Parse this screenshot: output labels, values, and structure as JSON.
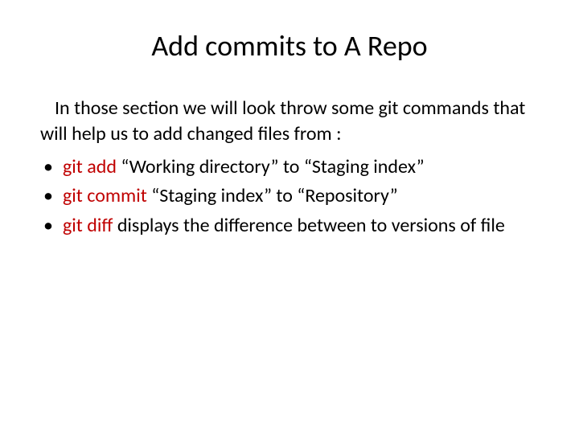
{
  "title": "Add commits to A Repo",
  "intro": "In those section we will look throw some git commands that will help us to add changed files from :",
  "items": [
    {
      "cmd": "git add",
      "desc": " “Working directory” to “Staging index”"
    },
    {
      "cmd": "git commit",
      "desc": " “Staging index” to “Repository”"
    },
    {
      "cmd": "git diff",
      "desc": "  displays the difference between to versions of file"
    }
  ]
}
